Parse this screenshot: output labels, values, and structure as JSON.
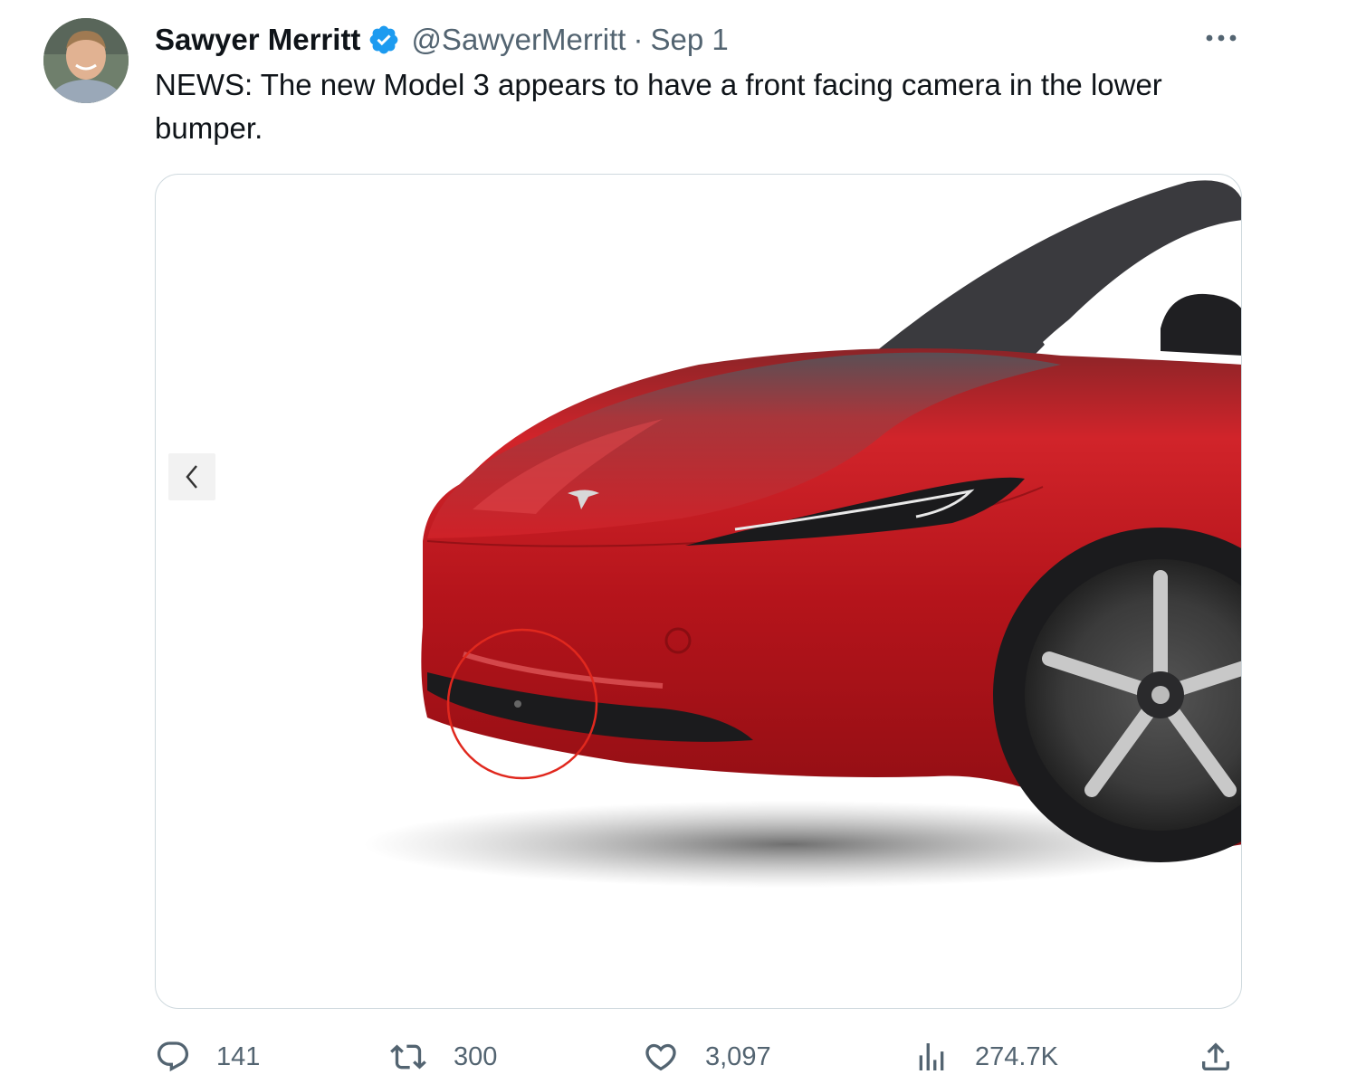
{
  "tweet": {
    "author": {
      "display_name": "Sawyer Merritt",
      "handle": "@SawyerMerritt",
      "verified": true
    },
    "separator": "·",
    "timestamp": "Sep 1",
    "text": "NEWS: The new Model 3 appears to have a front facing camera in the lower bumper.",
    "media": {
      "has_prev_button": true,
      "annotation": "red-circle"
    },
    "actions": {
      "replies": "141",
      "retweets": "300",
      "likes": "3,097",
      "views": "274.7K"
    }
  },
  "colors": {
    "verified_badge": "#1d9bf0",
    "secondary_text": "#536471",
    "primary_text": "#0f1419",
    "annotation_circle": "#e0281e",
    "car_paint": "#c4161c"
  }
}
